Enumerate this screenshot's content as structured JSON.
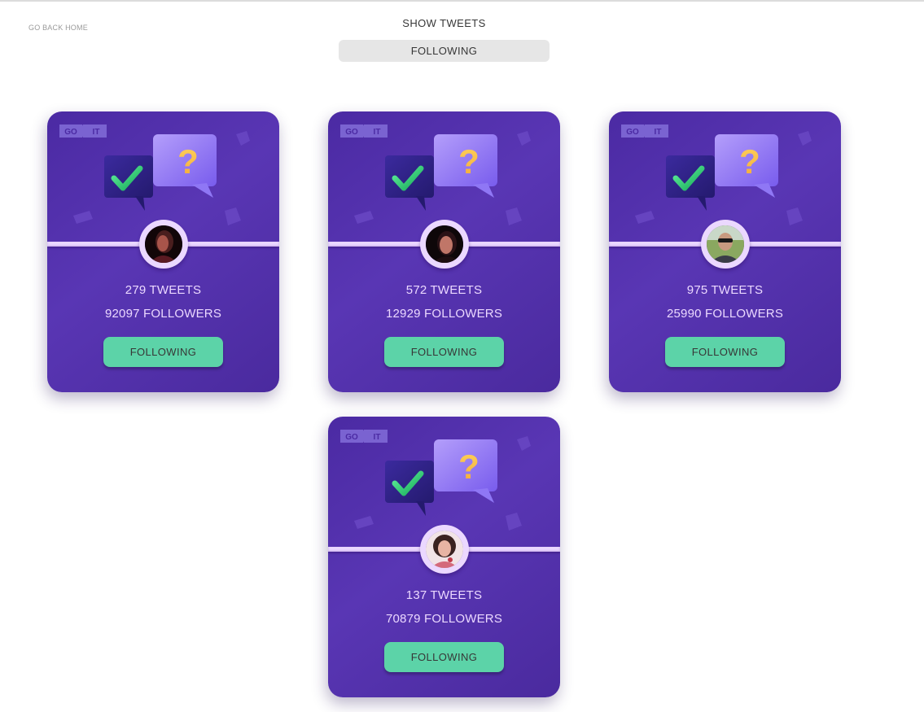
{
  "nav": {
    "back_label": "GO BACK HOME"
  },
  "filter": {
    "title": "SHOW TWEETS",
    "selected": "FOLLOWING"
  },
  "logo": {
    "left": "GO",
    "right": "IT"
  },
  "colors": {
    "card": "#5736a3",
    "accent": "#ebd8ff",
    "button": "#5cd3a8"
  },
  "cards": [
    {
      "tweets": "279 TWEETS",
      "followers": "92097 FOLLOWERS",
      "button_label": "FOLLOWING"
    },
    {
      "tweets": "572 TWEETS",
      "followers": "12929 FOLLOWERS",
      "button_label": "FOLLOWING"
    },
    {
      "tweets": "975 TWEETS",
      "followers": "25990 FOLLOWERS",
      "button_label": "FOLLOWING"
    },
    {
      "tweets": "137 TWEETS",
      "followers": "70879 FOLLOWERS",
      "button_label": "FOLLOWING"
    }
  ]
}
